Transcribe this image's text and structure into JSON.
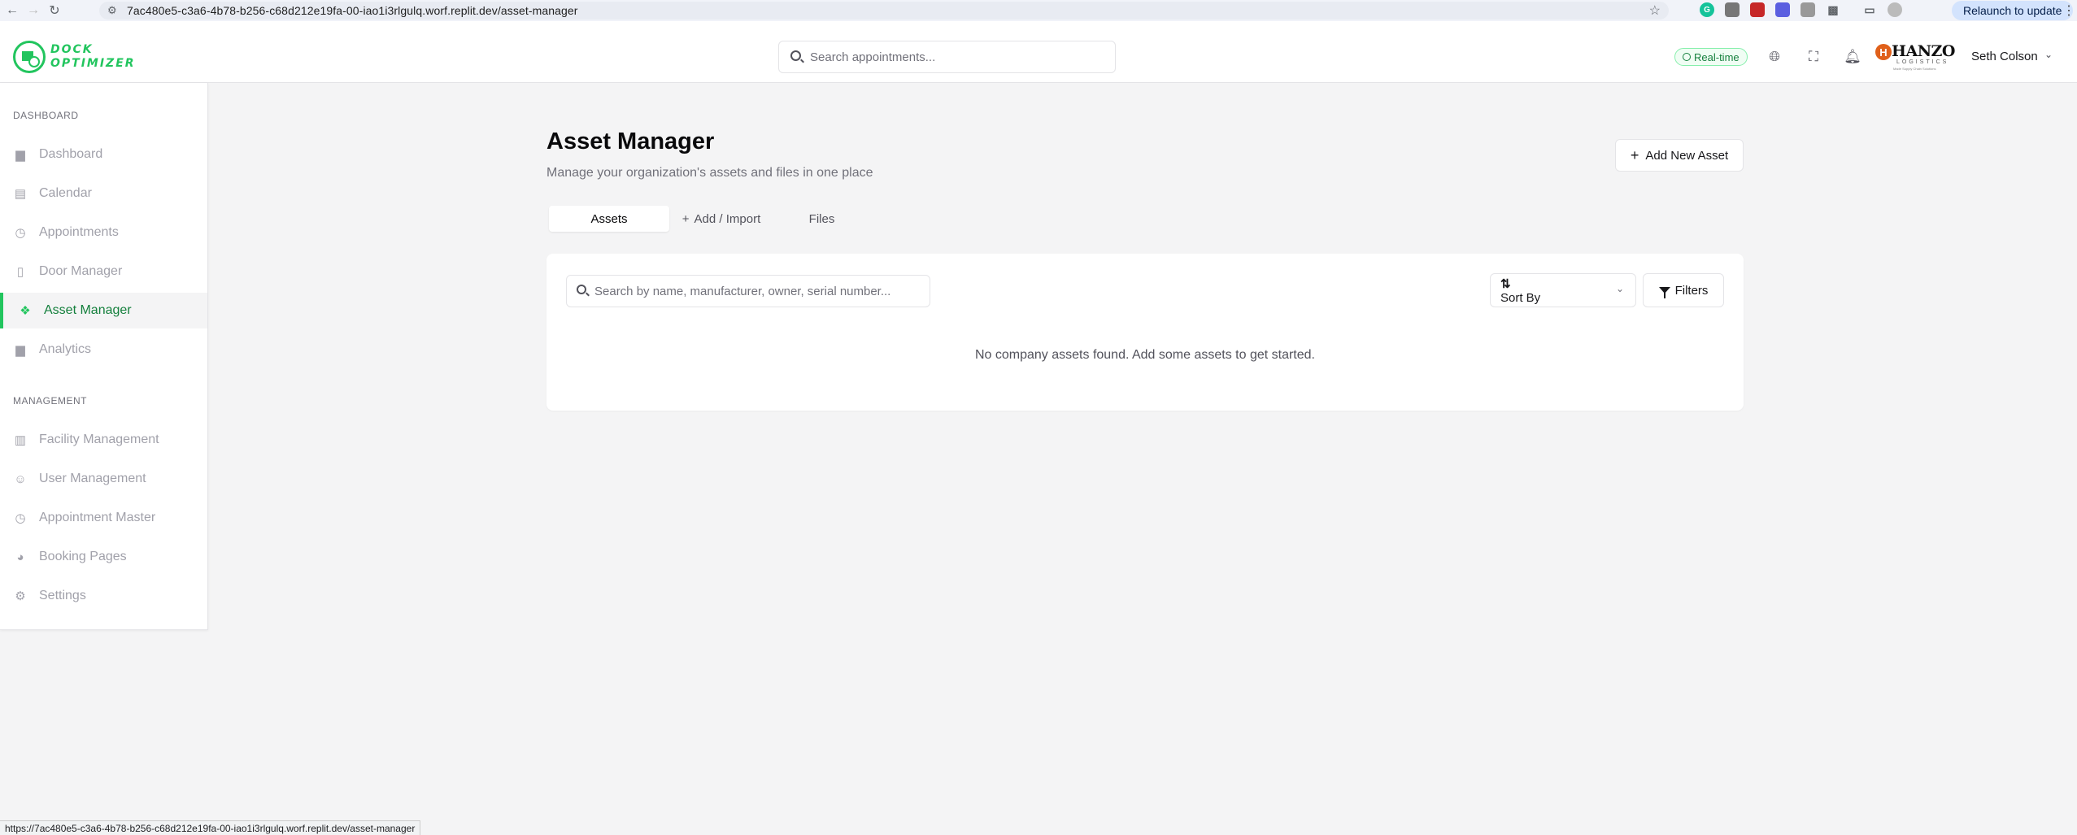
{
  "browser": {
    "url": "7ac480e5-c3a6-4b78-b256-c68d212e19fa-00-iao1i3rlgulq.worf.replit.dev/asset-manager",
    "relaunch_label": "Relaunch to update",
    "status_url": "https://7ac480e5-c3a6-4b78-b256-c68d212e19fa-00-iao1i3rlgulq.worf.replit.dev/asset-manager"
  },
  "header": {
    "logo_line1": "DOCK",
    "logo_line2": "OPTIMIZER",
    "search_placeholder": "Search appointments...",
    "realtime_label": "Real-time",
    "org_logo": {
      "title": "HANZO",
      "subtitle": "LOGISTICS",
      "tagline": "Made Supply Chain Solutions"
    },
    "user_name": "Seth Colson"
  },
  "sidebar": {
    "dashboard_section": "DASHBOARD",
    "dashboard_items": [
      {
        "label": "Dashboard",
        "icon": "bar-chart-icon"
      },
      {
        "label": "Calendar",
        "icon": "calendar-icon"
      },
      {
        "label": "Appointments",
        "icon": "calendar-clock-icon"
      },
      {
        "label": "Door Manager",
        "icon": "door-icon"
      },
      {
        "label": "Asset Manager",
        "icon": "asset-icon",
        "active": true
      },
      {
        "label": "Analytics",
        "icon": "bar-chart-icon"
      }
    ],
    "management_section": "MANAGEMENT",
    "management_items": [
      {
        "label": "Facility Management",
        "icon": "building-icon"
      },
      {
        "label": "User Management",
        "icon": "users-icon"
      },
      {
        "label": "Appointment Master",
        "icon": "calendar-clock-icon"
      },
      {
        "label": "Booking Pages",
        "icon": "globe-icon"
      },
      {
        "label": "Settings",
        "icon": "gear-icon"
      }
    ]
  },
  "main": {
    "title": "Asset Manager",
    "subtitle": "Manage your organization's assets and files in one place",
    "add_button": "Add New Asset",
    "tabs": [
      {
        "label": "Assets",
        "active": true
      },
      {
        "label": "Add / Import"
      },
      {
        "label": "Files"
      }
    ],
    "search_placeholder": "Search by name, manufacturer, owner, serial number...",
    "sort_label": "Sort By",
    "filters_label": "Filters",
    "empty_message": "No company assets found. Add some assets to get started."
  },
  "colors": {
    "accent": "#22c55e",
    "background": "#f4f4f5"
  }
}
